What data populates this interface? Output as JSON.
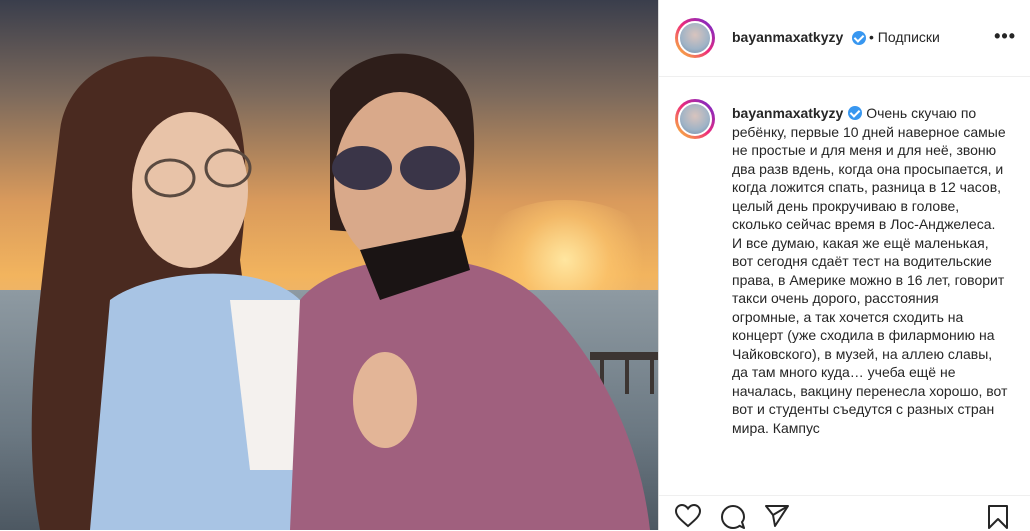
{
  "post": {
    "username": "bayanmaxatkyzy",
    "follow_label": "• Подписки",
    "more_label": "•••",
    "caption": "Очень скучаю по ребёнку, первые 10 дней наверное самые не простые и для меня и для неё, звоню два разв вдень, когда она просыпается, и когда ложится спать, разница в 12 часов, целый день прокручиваю в голове, сколько сейчас время в Лос-Анджелеса. И все думаю, какая же ещё маленькая, вот сегодня сдаёт тест на водительские права, в Америке можно в 16 лет, говорит такси очень дорого, расстояния огромные, а так хочется сходить на концерт (уже сходила в филармонию на Чайковского), в музей, на аллею славы, да там много куда… учеба ещё не началась, вакцину перенесла хорошо, вот вот и студенты съедутся с разных стран мира. Кампус"
  },
  "icons": {
    "verified": "verified-badge-icon",
    "like": "heart-icon",
    "comment": "comment-icon",
    "share": "paper-plane-icon",
    "save": "bookmark-icon"
  },
  "colors": {
    "verified": "#3897f0",
    "text": "#262626",
    "border": "#dbdbdb"
  }
}
